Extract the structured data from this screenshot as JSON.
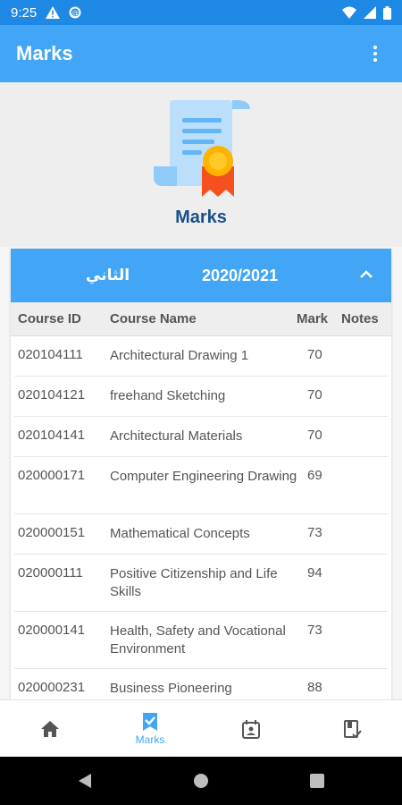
{
  "status_bar": {
    "time": "9:25"
  },
  "app_bar": {
    "title": "Marks",
    "menu_icon": "more-vert-icon"
  },
  "hero": {
    "title": "Marks",
    "icon": "certificate-icon"
  },
  "term_card": {
    "term": "الثاني",
    "year": "2020/2021",
    "expanded": true,
    "columns": [
      "Course ID",
      "Course Name",
      "Mark",
      "Notes"
    ],
    "rows": [
      {
        "id": "020104111",
        "name": "Architectural Drawing 1",
        "mark": "70",
        "notes": ""
      },
      {
        "id": "020104121",
        "name": "freehand Sketching",
        "mark": "70",
        "notes": ""
      },
      {
        "id": "020104141",
        "name": "Architectural Materials",
        "mark": "70",
        "notes": ""
      },
      {
        "id": "020000171",
        "name": "Computer Engineering Drawing",
        "mark": "69",
        "notes": ""
      },
      {
        "id": "020000151",
        "name": "Mathematical Concepts",
        "mark": "73",
        "notes": ""
      },
      {
        "id": "020000111",
        "name": "Positive Citizenship and Life Skills",
        "mark": "94",
        "notes": ""
      },
      {
        "id": "020000141",
        "name": "Health, Safety and Vocational Environment",
        "mark": "73",
        "notes": ""
      },
      {
        "id": "020000231",
        "name": "Business Pioneering",
        "mark": "88",
        "notes": ""
      }
    ]
  },
  "bottom_nav": {
    "items": [
      {
        "icon": "home-icon",
        "label": "",
        "active": false
      },
      {
        "icon": "marks-icon",
        "label": "Marks",
        "active": true
      },
      {
        "icon": "schedule-icon",
        "label": "",
        "active": false
      },
      {
        "icon": "book-check-icon",
        "label": "",
        "active": false
      }
    ]
  },
  "colors": {
    "primary": "#42a5f5",
    "status_bar": "#1e88e5",
    "hero_title": "#1a4f8a"
  }
}
